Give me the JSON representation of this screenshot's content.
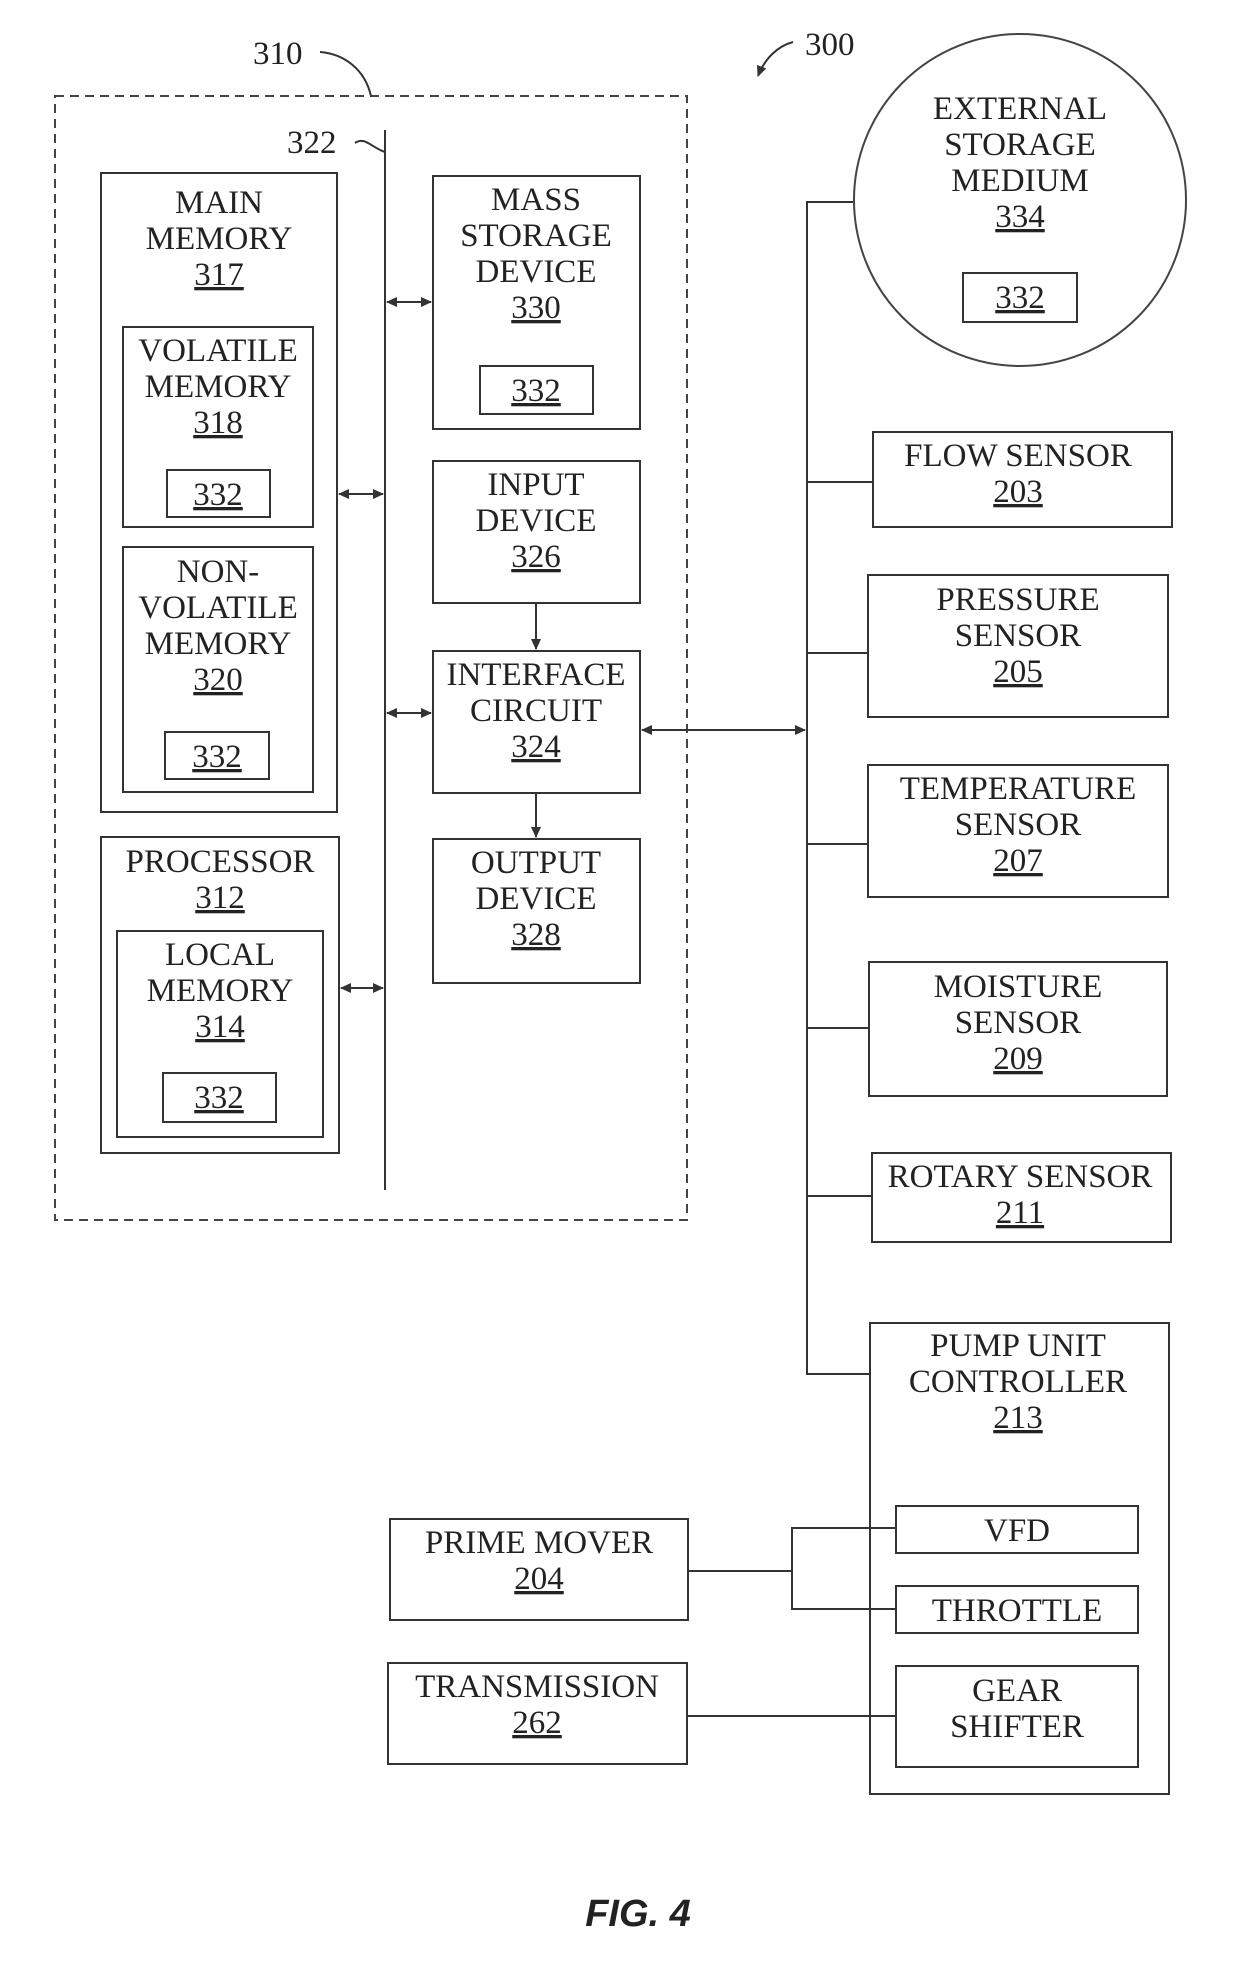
{
  "figure": {
    "title": "FIG. 4",
    "system_ref": "300",
    "computing_block_ref": "310",
    "bus_ref": "322"
  },
  "blocks": {
    "main_memory": {
      "lines": [
        "MAIN",
        "MEMORY"
      ],
      "ref": "317"
    },
    "volatile_memory": {
      "lines": [
        "VOLATILE",
        "MEMORY"
      ],
      "ref": "318",
      "instructions_ref": "332"
    },
    "non_volatile_memory": {
      "lines": [
        "NON-",
        "VOLATILE",
        "MEMORY"
      ],
      "ref": "320",
      "instructions_ref": "332"
    },
    "processor": {
      "lines": [
        "PROCESSOR"
      ],
      "ref": "312"
    },
    "local_memory": {
      "lines": [
        "LOCAL",
        "MEMORY"
      ],
      "ref": "314",
      "instructions_ref": "332"
    },
    "mass_storage": {
      "lines": [
        "MASS",
        "STORAGE",
        "DEVICE"
      ],
      "ref": "330",
      "instructions_ref": "332"
    },
    "input_device": {
      "lines": [
        "INPUT",
        "DEVICE"
      ],
      "ref": "326"
    },
    "interface_circuit": {
      "lines": [
        "INTERFACE",
        "CIRCUIT"
      ],
      "ref": "324"
    },
    "output_device": {
      "lines": [
        "OUTPUT",
        "DEVICE"
      ],
      "ref": "328"
    },
    "external_storage": {
      "lines": [
        "EXTERNAL",
        "STORAGE",
        "MEDIUM"
      ],
      "ref": "334",
      "instructions_ref": "332"
    },
    "flow_sensor": {
      "lines": [
        "FLOW SENSOR"
      ],
      "ref": "203"
    },
    "pressure_sensor": {
      "lines": [
        "PRESSURE",
        "SENSOR"
      ],
      "ref": "205"
    },
    "temperature_sensor": {
      "lines": [
        "TEMPERATURE",
        "SENSOR"
      ],
      "ref": "207"
    },
    "moisture_sensor": {
      "lines": [
        "MOISTURE",
        "SENSOR"
      ],
      "ref": "209"
    },
    "rotary_sensor": {
      "lines": [
        "ROTARY SENSOR"
      ],
      "ref": "211"
    },
    "pump_unit_controller": {
      "lines": [
        "PUMP UNIT",
        "CONTROLLER"
      ],
      "ref": "213"
    },
    "vfd": {
      "lines": [
        "VFD"
      ]
    },
    "throttle": {
      "lines": [
        "THROTTLE"
      ]
    },
    "gear_shifter": {
      "lines": [
        "GEAR",
        "SHIFTER"
      ]
    },
    "prime_mover": {
      "lines": [
        "PRIME MOVER"
      ],
      "ref": "204"
    },
    "transmission": {
      "lines": [
        "TRANSMISSION"
      ],
      "ref": "262"
    }
  }
}
